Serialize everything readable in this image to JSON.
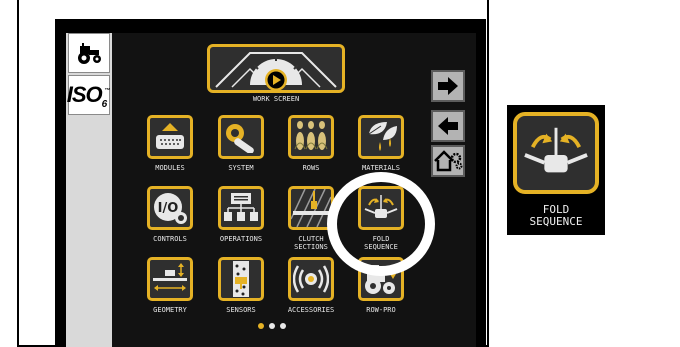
{
  "left_strip": {
    "tractor_icon": "tractor-icon",
    "iso_logo": {
      "main": "ISO",
      "subscript": "6",
      "trademark": "™"
    }
  },
  "work_screen": {
    "label": "WORK SCREEN",
    "icon": "play-gauge-icon"
  },
  "tiles": [
    {
      "label": "MODULES",
      "icon": "modules-icon"
    },
    {
      "label": "SYSTEM",
      "icon": "wrench-icon"
    },
    {
      "label": "ROWS",
      "icon": "corn-rows-icon"
    },
    {
      "label": "MATERIALS",
      "icon": "leaf-drops-icon"
    },
    {
      "label": "CONTROLS",
      "icon": "io-controls-icon"
    },
    {
      "label": "OPERATIONS",
      "icon": "operations-tree-icon"
    },
    {
      "label_line1": "CLUTCH",
      "label_line2": "SECTIONS",
      "icon": "clutch-sections-icon"
    },
    {
      "label_line1": "FOLD",
      "label_line2": "SEQUENCE",
      "icon": "fold-sequence-icon"
    },
    {
      "label": "GEOMETRY",
      "icon": "geometry-icon"
    },
    {
      "label": "SENSORS",
      "icon": "sensors-icon"
    },
    {
      "label": "ACCESSORIES",
      "icon": "accessories-icon"
    },
    {
      "label": "ROW-PRO",
      "icon": "row-pro-icon"
    }
  ],
  "nav_buttons": [
    {
      "icon": "arrow-right-icon"
    },
    {
      "icon": "arrow-left-icon"
    },
    {
      "icon": "home-gear-icon"
    }
  ],
  "pagination": {
    "current_page": 1,
    "total_pages": 3
  },
  "zoom_callout": {
    "label_line1": "FOLD",
    "label_line2": "SEQUENCE",
    "icon": "fold-sequence-icon"
  },
  "colors": {
    "accent": "#e5b225",
    "tile_bg": "#2f2f2f",
    "screen_bg": "#121212",
    "label": "#e8e8e8"
  }
}
